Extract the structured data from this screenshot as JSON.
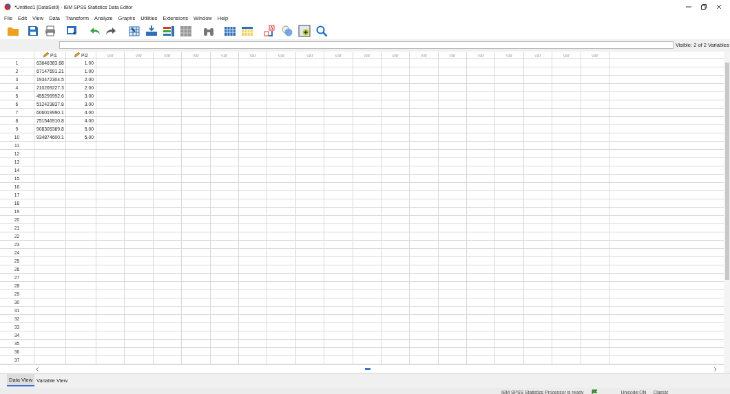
{
  "window": {
    "title": "*Untitled1 [DataSet0] - IBM SPSS Statistics Data Editor"
  },
  "menu": [
    "File",
    "Edit",
    "View",
    "Data",
    "Transform",
    "Analyze",
    "Graphs",
    "Utilities",
    "Extensions",
    "Window",
    "Help"
  ],
  "visible_variables": "Visible: 2 of 2 Variables",
  "grid": {
    "columns": [
      {
        "kind": "variable",
        "label": "Pi1"
      },
      {
        "kind": "variable",
        "label": "Pi2"
      },
      {
        "kind": "placeholder",
        "label": "var"
      },
      {
        "kind": "placeholder",
        "label": "var"
      },
      {
        "kind": "placeholder",
        "label": "var"
      },
      {
        "kind": "placeholder",
        "label": "var"
      },
      {
        "kind": "placeholder",
        "label": "var"
      },
      {
        "kind": "placeholder",
        "label": "var"
      },
      {
        "kind": "placeholder",
        "label": "var"
      },
      {
        "kind": "placeholder",
        "label": "var"
      },
      {
        "kind": "placeholder",
        "label": "var"
      },
      {
        "kind": "placeholder",
        "label": "var"
      },
      {
        "kind": "placeholder",
        "label": "var"
      },
      {
        "kind": "placeholder",
        "label": "var"
      },
      {
        "kind": "placeholder",
        "label": "var"
      },
      {
        "kind": "placeholder",
        "label": "var"
      },
      {
        "kind": "placeholder",
        "label": "var"
      },
      {
        "kind": "placeholder",
        "label": "var"
      },
      {
        "kind": "placeholder",
        "label": "var"
      },
      {
        "kind": "placeholder",
        "label": "var"
      }
    ],
    "rows": [
      {
        "number": "1",
        "cells": [
          "63646383.68",
          "1.00"
        ]
      },
      {
        "number": "2",
        "cells": [
          "67147691.21",
          "1.00"
        ]
      },
      {
        "number": "3",
        "cells": [
          "193472304.5",
          "2.00"
        ]
      },
      {
        "number": "4",
        "cells": [
          "210269227.3",
          "2.00"
        ]
      },
      {
        "number": "5",
        "cells": [
          "455299992.6",
          "3.00"
        ]
      },
      {
        "number": "6",
        "cells": [
          "512423837.8",
          "3.00"
        ]
      },
      {
        "number": "7",
        "cells": [
          "606019990.1",
          "4.00"
        ]
      },
      {
        "number": "8",
        "cells": [
          "751546910.8",
          "4.00"
        ]
      },
      {
        "number": "9",
        "cells": [
          "908305369.8",
          "5.00"
        ]
      },
      {
        "number": "10",
        "cells": [
          "934874600.1",
          "5.00"
        ]
      },
      {
        "number": "11"
      },
      {
        "number": "12"
      },
      {
        "number": "13"
      },
      {
        "number": "14"
      },
      {
        "number": "15"
      },
      {
        "number": "16"
      },
      {
        "number": "17"
      },
      {
        "number": "18"
      },
      {
        "number": "19"
      },
      {
        "number": "20"
      },
      {
        "number": "21"
      },
      {
        "number": "22"
      },
      {
        "number": "23"
      },
      {
        "number": "24"
      },
      {
        "number": "25"
      },
      {
        "number": "26"
      },
      {
        "number": "27"
      },
      {
        "number": "28"
      },
      {
        "number": "29"
      },
      {
        "number": "30"
      },
      {
        "number": "31"
      },
      {
        "number": "32"
      },
      {
        "number": "33"
      },
      {
        "number": "34"
      },
      {
        "number": "35"
      },
      {
        "number": "36"
      },
      {
        "number": "37"
      }
    ]
  },
  "tabs": [
    {
      "label": "Data View",
      "selected": true
    },
    {
      "label": "Variable View",
      "selected": false
    }
  ],
  "status_bar": {
    "processor": "IBM SPSS Statistics Processor is ready",
    "unicode": "Unicode:ON",
    "mode": "Classic"
  }
}
